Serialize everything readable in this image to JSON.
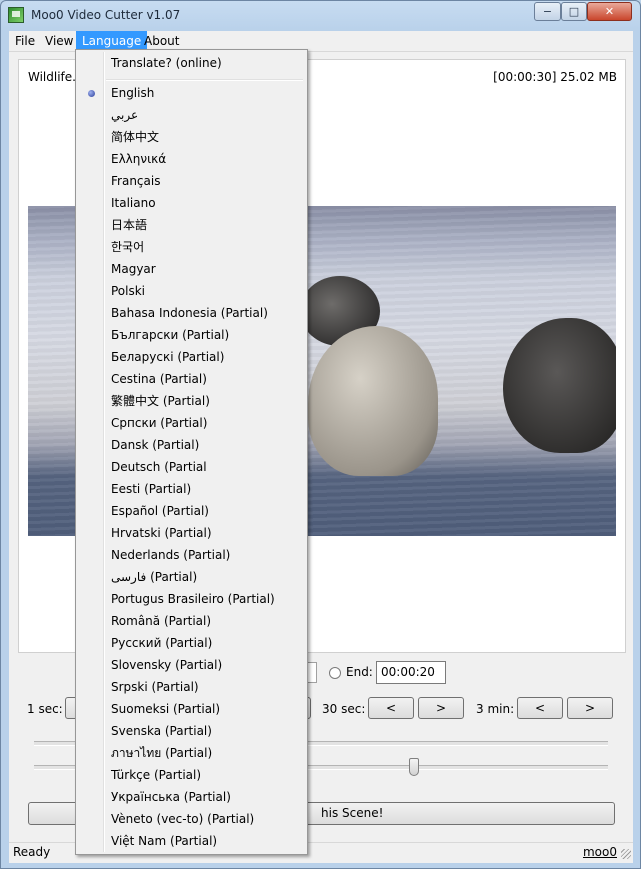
{
  "window": {
    "title": "Moo0 Video Cutter v1.07",
    "controls": {
      "minimize": "−",
      "maximize": "□",
      "close": "✕"
    }
  },
  "menubar": {
    "file": "File",
    "view": "View",
    "language": "Language",
    "about": "About"
  },
  "file": {
    "name": "Wildlife.wmv",
    "info": "[00:00:30]   25.02 MB"
  },
  "video": {
    "description_icon": "video-preview"
  },
  "end": {
    "label": "End:",
    "value": "00:00:20"
  },
  "steps": {
    "one_sec": "1 sec:",
    "thirty_sec": "30 sec:",
    "three_min": "3 min:",
    "prev": "<",
    "next": ">"
  },
  "cut_button": {
    "label": "Cut This Scene!",
    "visible_fragment": "his Scene!"
  },
  "status": {
    "text": "Ready",
    "link": "moo0"
  },
  "language_menu": {
    "translate": "Translate? (online)",
    "selected": "English",
    "items": [
      "English",
      "عربي",
      "简体中文",
      "Ελληνικά",
      "Français",
      "Italiano",
      "日本語",
      "한국어",
      "Magyar",
      "Polski",
      "Bahasa Indonesia (Partial)",
      "Български (Partial)",
      "Беларускі (Partial)",
      "Cestina (Partial)",
      "繁體中文 (Partial)",
      "Српски (Partial)",
      "Dansk (Partial)",
      "Deutsch (Partial",
      "Eesti (Partial)",
      "Español (Partial)",
      "Hrvatski (Partial)",
      "Nederlands (Partial)",
      "فارسی (Partial)",
      "Portugus Brasileiro (Partial)",
      "Română (Partial)",
      "Русский (Partial)",
      "Slovensky (Partial)",
      "Srpski (Partial)",
      "Suomeksi (Partial)",
      "Svenska (Partial)",
      "ภาษาไทย (Partial)",
      "Türkçe (Partial)",
      "Українська (Partial)",
      "Vèneto (vec-to) (Partial)",
      "Việt Nam (Partial)"
    ]
  }
}
